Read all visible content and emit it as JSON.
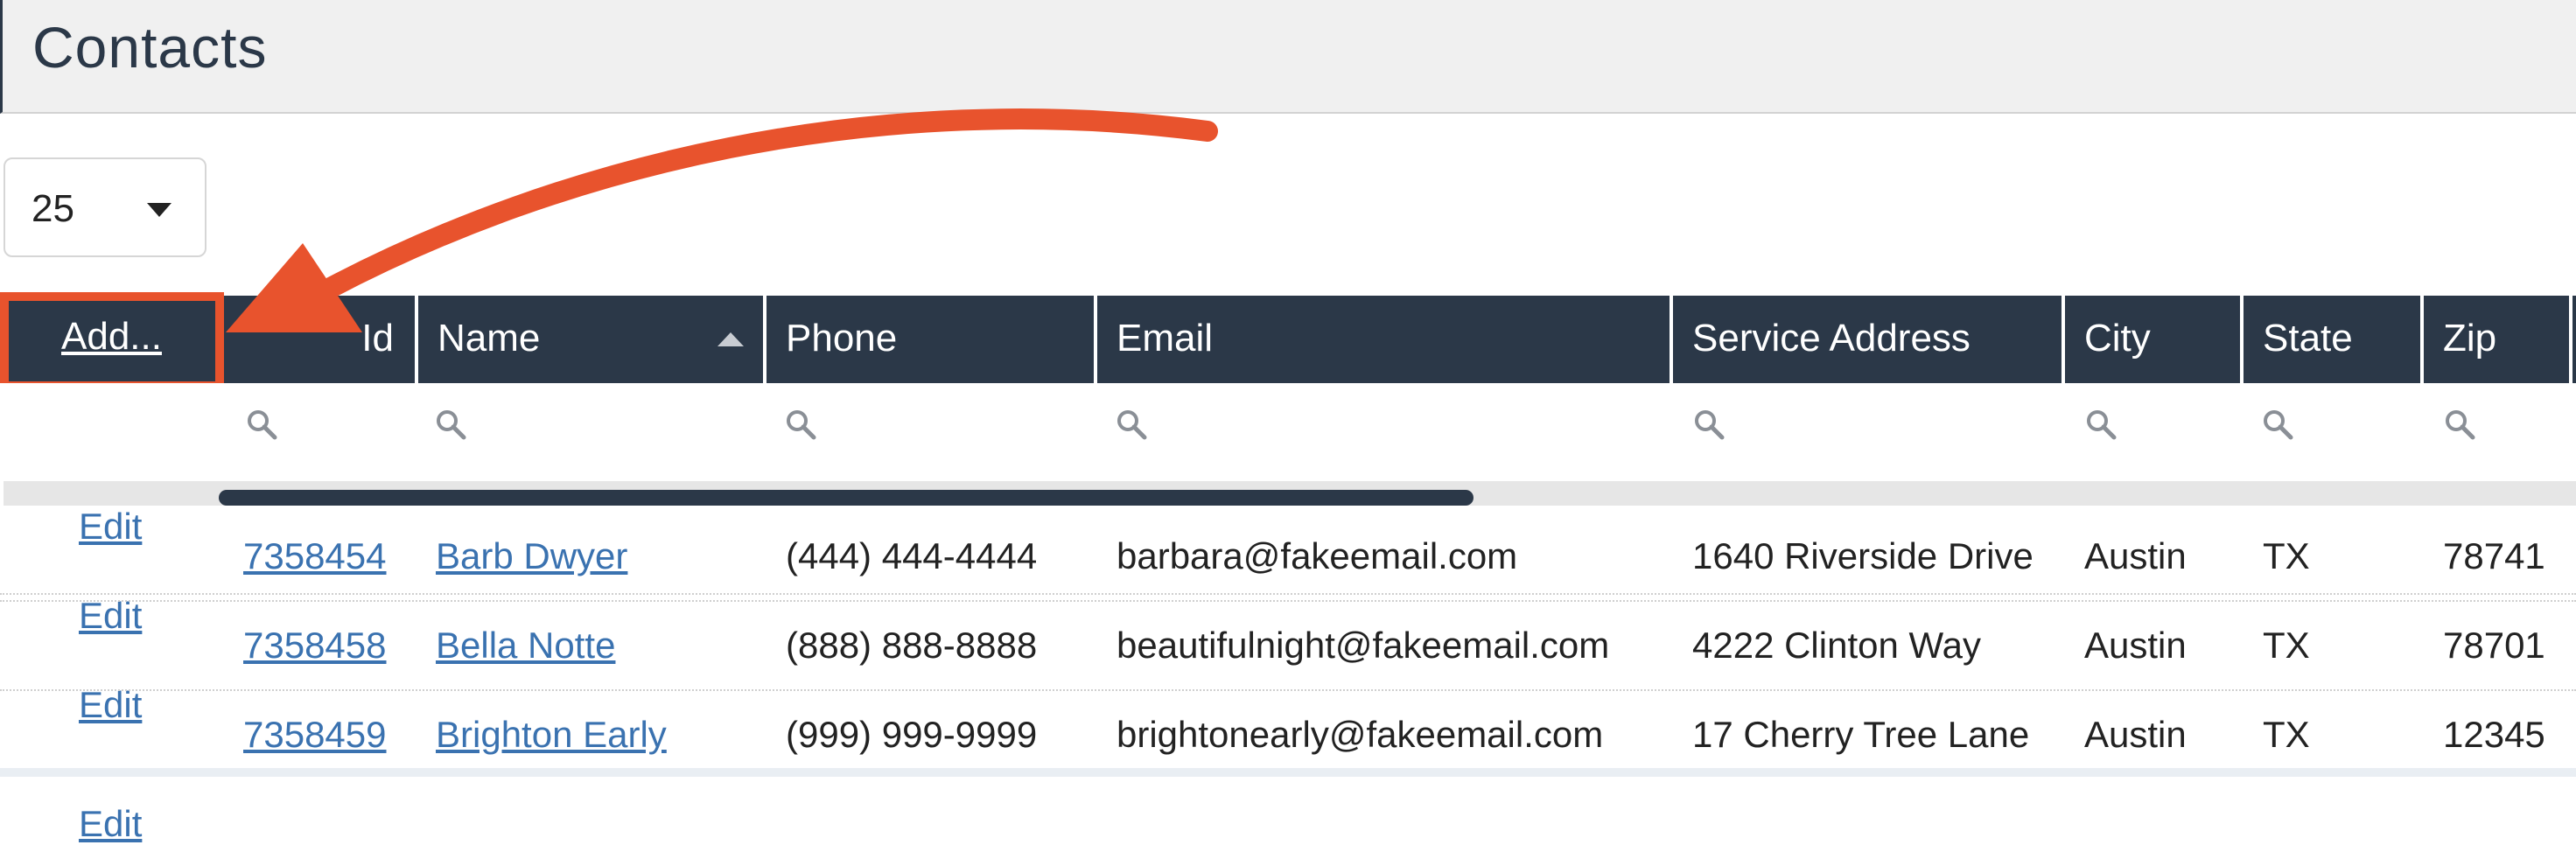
{
  "page": {
    "title": "Contacts"
  },
  "page_size": {
    "value": "25"
  },
  "toolbar": {
    "add_label": "Add..."
  },
  "columns": [
    {
      "key": "id",
      "label": "Id"
    },
    {
      "key": "name",
      "label": "Name",
      "sorted": "ascending"
    },
    {
      "key": "phone",
      "label": "Phone"
    },
    {
      "key": "email",
      "label": "Email"
    },
    {
      "key": "address",
      "label": "Service Address"
    },
    {
      "key": "city",
      "label": "City"
    },
    {
      "key": "state",
      "label": "State"
    },
    {
      "key": "zip",
      "label": "Zip"
    }
  ],
  "row_action_label": "Edit",
  "rows": [
    {
      "id": "7358454",
      "name": "Barb Dwyer",
      "phone": "(444) 444-4444",
      "email": "barbara@fakeemail.com",
      "address": "1640 Riverside Drive",
      "city": "Austin",
      "state": "TX",
      "zip": "78741"
    },
    {
      "id": "7358458",
      "name": "Bella Notte",
      "phone": "(888) 888-8888",
      "email": "beautifulnight@fakeemail.com",
      "address": "4222 Clinton Way",
      "city": "Austin",
      "state": "TX",
      "zip": "78701"
    },
    {
      "id": "7358459",
      "name": "Brighton Early",
      "phone": "(999) 999-9999",
      "email": "brightonearly@fakeemail.com",
      "address": "17 Cherry Tree Lane",
      "city": "Austin",
      "state": "TX",
      "zip": "12345"
    }
  ],
  "colors": {
    "header_bg": "#2b3848",
    "link": "#3a72b0",
    "annotation": "#e8532d"
  }
}
